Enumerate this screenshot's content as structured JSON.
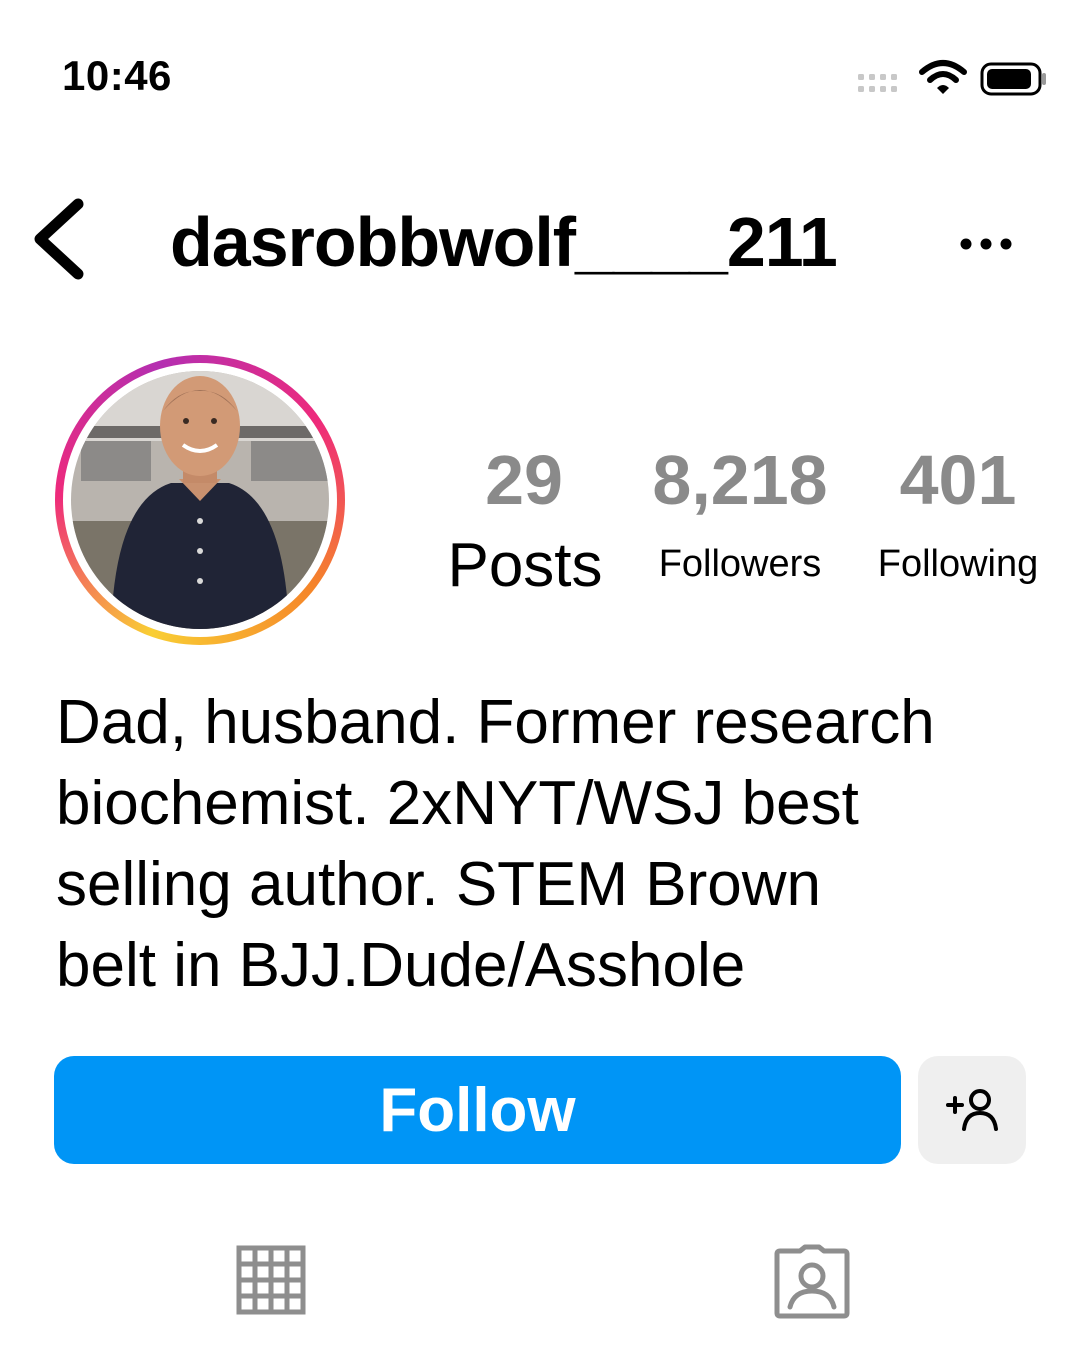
{
  "status_bar": {
    "time": "10:46",
    "icons": [
      "cellular-signal-icon",
      "wifi-icon",
      "battery-icon"
    ]
  },
  "header": {
    "back_icon": "chevron-left-icon",
    "username": "dasrobbwolf____211",
    "more_icon": "ellipsis-icon"
  },
  "profile": {
    "stats": {
      "posts": {
        "value": "29",
        "label": "Posts"
      },
      "followers": {
        "value": "8,218",
        "label": "Followers"
      },
      "following": {
        "value": "401",
        "label": "Following"
      }
    },
    "bio_lines": [
      "Dad, husband. Former research",
      "biochemist. 2xNYT/WSJ best",
      "selling author. STEM Brown",
      "belt in BJJ.Dude/Asshole"
    ]
  },
  "actions": {
    "follow_label": "Follow",
    "suggest_icon": "add-person-icon"
  },
  "tabs": [
    "grid-icon",
    "tagged-icon"
  ],
  "colors": {
    "follow_blue": "#0095f6",
    "stat_gray": "#8a8a8a",
    "icon_gray": "#8e8e8e",
    "secondary_button": "#efefef"
  }
}
